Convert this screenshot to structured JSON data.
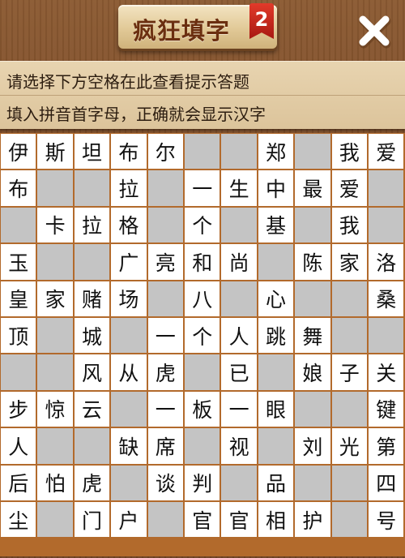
{
  "header": {
    "title": "疯狂填字",
    "badge": "2",
    "close_icon": "close-icon"
  },
  "hints": {
    "line1": "请选择下方空格在此查看提示答题",
    "line2": "填入拼音首字母，正确就会显示汉字"
  },
  "colors": {
    "wood": "#7a4a26",
    "hint_bg": "#e4cfa8",
    "grid_line": "#b26a2c",
    "cell_white": "#ffffff",
    "cell_gray": "#c4c4c4",
    "badge_red": "#d12a1e"
  },
  "grid": {
    "rows": 11,
    "cols": 11,
    "cells": [
      [
        "伊",
        "斯",
        "坦",
        "布",
        "尔",
        "",
        "",
        "郑",
        "",
        "我",
        "爱"
      ],
      [
        "布",
        "",
        "",
        "拉",
        "",
        "一",
        "生",
        "中",
        "最",
        "爱",
        ""
      ],
      [
        "",
        "卡",
        "拉",
        "格",
        "",
        "个",
        "",
        "基",
        "",
        "我",
        ""
      ],
      [
        "玉",
        "",
        "",
        "广",
        "亮",
        "和",
        "尚",
        "",
        "陈",
        "家",
        "洛"
      ],
      [
        "皇",
        "家",
        "赌",
        "场",
        "",
        "八",
        "",
        "心",
        "",
        "",
        "桑"
      ],
      [
        "顶",
        "",
        "城",
        "",
        "一",
        "个",
        "人",
        "跳",
        "舞",
        "",
        ""
      ],
      [
        "",
        "",
        "风",
        "从",
        "虎",
        "",
        "已",
        "",
        "娘",
        "子",
        "关"
      ],
      [
        "步",
        "惊",
        "云",
        "",
        "一",
        "板",
        "一",
        "眼",
        "",
        "",
        "键"
      ],
      [
        "人",
        "",
        "",
        "缺",
        "席",
        "",
        "视",
        "",
        "刘",
        "光",
        "第"
      ],
      [
        "后",
        "怕",
        "虎",
        "",
        "谈",
        "判",
        "",
        "品",
        "",
        "",
        "四"
      ],
      [
        "尘",
        "",
        "门",
        "户",
        "",
        "官",
        "官",
        "相",
        "护",
        "",
        "号"
      ]
    ]
  }
}
